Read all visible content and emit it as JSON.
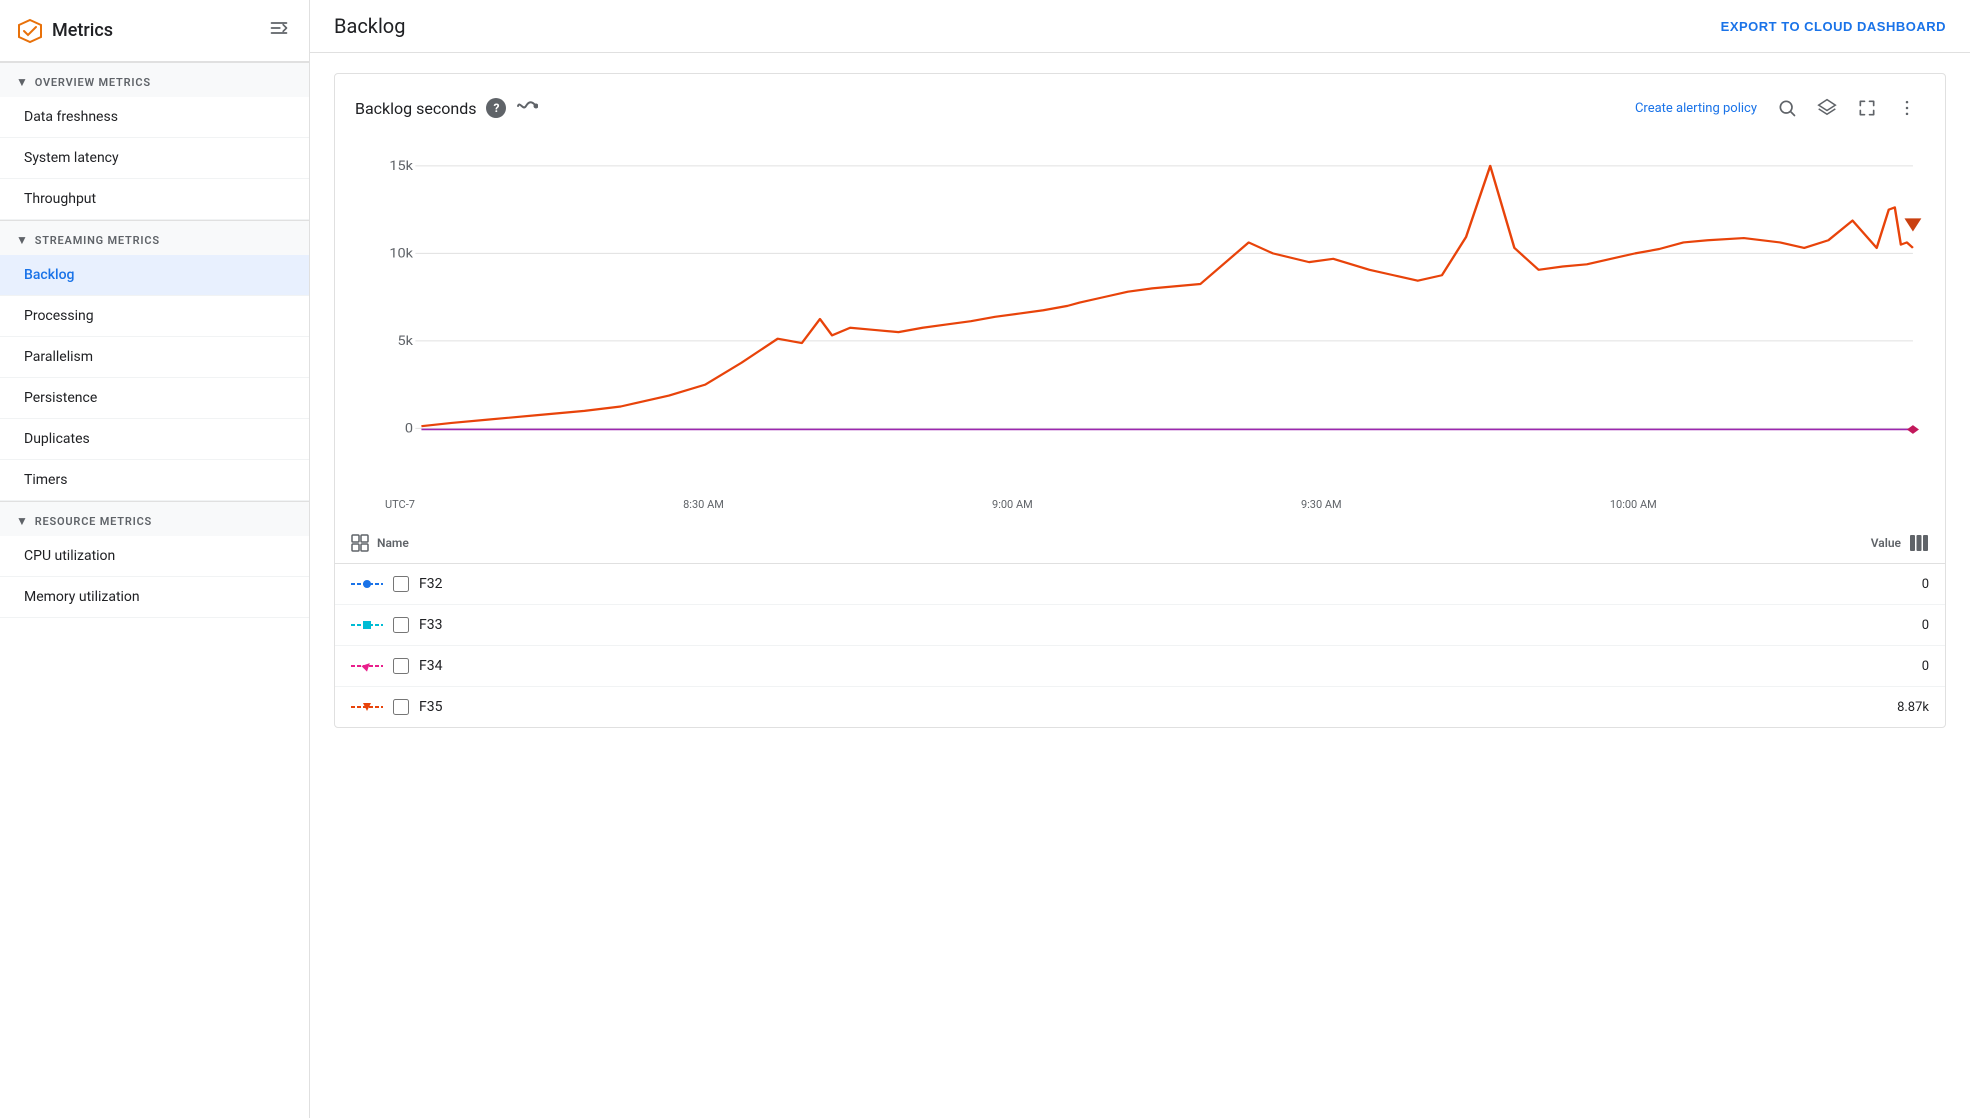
{
  "sidebar": {
    "logo_text": "Metrics",
    "collapse_icon": "⊣",
    "sections": [
      {
        "id": "overview",
        "label": "OVERVIEW METRICS",
        "items": [
          {
            "id": "data-freshness",
            "label": "Data freshness",
            "active": false
          },
          {
            "id": "system-latency",
            "label": "System latency",
            "active": false
          },
          {
            "id": "throughput",
            "label": "Throughput",
            "active": false
          }
        ]
      },
      {
        "id": "streaming",
        "label": "STREAMING METRICS",
        "items": [
          {
            "id": "backlog",
            "label": "Backlog",
            "active": true
          },
          {
            "id": "processing",
            "label": "Processing",
            "active": false
          },
          {
            "id": "parallelism",
            "label": "Parallelism",
            "active": false
          },
          {
            "id": "persistence",
            "label": "Persistence",
            "active": false
          },
          {
            "id": "duplicates",
            "label": "Duplicates",
            "active": false
          },
          {
            "id": "timers",
            "label": "Timers",
            "active": false
          }
        ]
      },
      {
        "id": "resource",
        "label": "RESOURCE METRICS",
        "items": [
          {
            "id": "cpu-utilization",
            "label": "CPU utilization",
            "active": false
          },
          {
            "id": "memory-utilization",
            "label": "Memory utilization",
            "active": false
          }
        ]
      }
    ]
  },
  "header": {
    "title": "Backlog",
    "export_label": "EXPORT TO CLOUD DASHBOARD"
  },
  "chart": {
    "title": "Backlog seconds",
    "help_label": "?",
    "create_alert_label": "Create alerting policy",
    "y_labels": [
      "15k",
      "10k",
      "5k",
      "0"
    ],
    "x_labels": [
      "UTC-7",
      "8:30 AM",
      "9:00 AM",
      "9:30 AM",
      "10:00 AM",
      ""
    ],
    "legend": {
      "name_col": "Name",
      "value_col": "Value",
      "rows": [
        {
          "id": "F32",
          "name": "F32",
          "line_color": "#1a73e8",
          "shape": "circle",
          "value": "0"
        },
        {
          "id": "F33",
          "name": "F33",
          "line_color": "#00bcd4",
          "shape": "square",
          "value": "0"
        },
        {
          "id": "F34",
          "name": "F34",
          "line_color": "#e91e8c",
          "shape": "diamond",
          "value": "0"
        },
        {
          "id": "F35",
          "name": "F35",
          "line_color": "#e8430a",
          "shape": "triangle-down",
          "value": "8.87k"
        }
      ]
    }
  },
  "toolbar_icons": {
    "search": "🔍",
    "layers": "≡",
    "fullscreen": "⛶",
    "more": "⋮"
  }
}
